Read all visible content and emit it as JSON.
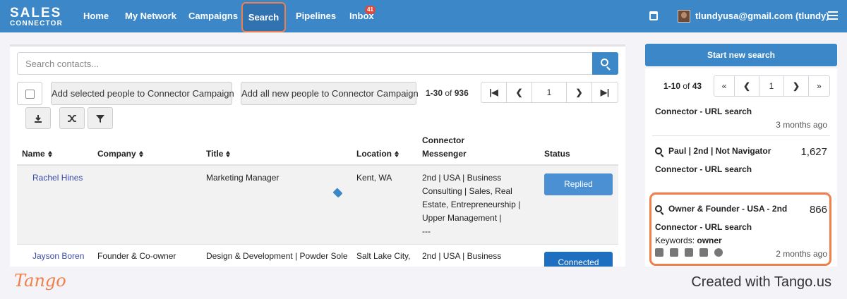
{
  "brand": {
    "line1": "SALES",
    "line2": "CONNECTOR"
  },
  "nav": {
    "items": [
      {
        "label": "Home"
      },
      {
        "label": "My Network"
      },
      {
        "label": "Campaigns"
      },
      {
        "label": "Search",
        "active": true
      },
      {
        "label": "Pipelines"
      },
      {
        "label": "Inbox",
        "badge": "41"
      }
    ],
    "user": "tlundyusa@gmail.com (tlundy)",
    "icons": [
      "calendar-icon",
      "avatar",
      "hamburger-menu-icon"
    ]
  },
  "search": {
    "placeholder": "Search contacts...",
    "value": ""
  },
  "toolbar": {
    "add_selected": "Add selected people to Connector Campaign",
    "add_all": "Add all new people to Connector Campaign",
    "range_prefix": "1-30",
    "range_of": "of",
    "range_total": "936",
    "page": "1"
  },
  "table": {
    "headers": {
      "name": "Name",
      "company": "Company",
      "title": "Title",
      "location": "Location",
      "messenger_1": "Connector",
      "messenger_2": "Messenger",
      "status": "Status"
    },
    "rows": [
      {
        "name": "Rachel Hines",
        "company": "",
        "title": "Marketing Manager",
        "location": "Kent, WA",
        "messenger": [
          "2nd | USA | Business",
          "Consulting | Sales, Real",
          "Estate, Entrepreneurship |",
          "Upper Management |",
          "---"
        ],
        "status": "Replied",
        "status_color": "#4a90d2"
      },
      {
        "name": "Jayson Boren",
        "company": "Founder & Co-owner",
        "title": "Design & Development | Powder Sole",
        "location": "Salt Lake City,",
        "messenger": [
          "2nd | USA | Business"
        ],
        "status": "Connected",
        "status_color": "#1e6fbf"
      }
    ]
  },
  "right": {
    "start_button": "Start new search",
    "range_prefix": "1-10",
    "range_of": "of",
    "range_total": "43",
    "page": "1",
    "saved_searches": [
      {
        "title": "",
        "count": "",
        "sub": "Connector - URL search",
        "time": "3 months ago"
      },
      {
        "title": "Paul | 2nd | Not Navigator",
        "count": "1,627",
        "sub": "Connector - URL search",
        "time": ""
      },
      {
        "title": "Owner & Founder - USA - 2nd",
        "count": "866",
        "sub": "Connector - URL search",
        "keywords_label": "Keywords:",
        "keywords": "owner",
        "time": "2 months ago"
      }
    ]
  },
  "footer": {
    "logo": "Tango",
    "text": "Created with Tango.us"
  },
  "colors": {
    "nav": "#3b87c8",
    "accent": "#f07f4a",
    "link": "#3a4aa8"
  }
}
